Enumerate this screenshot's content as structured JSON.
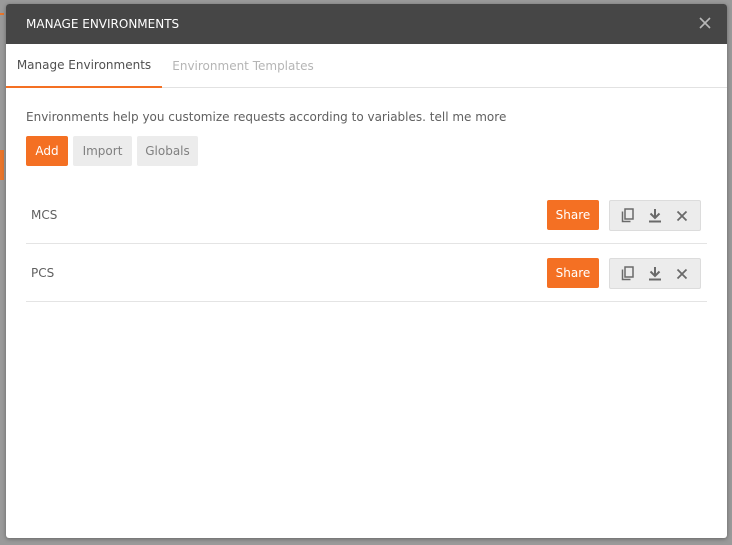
{
  "modal": {
    "title": "MANAGE ENVIRONMENTS",
    "close_icon": "close-icon"
  },
  "tabs": [
    {
      "label": "Manage Environments",
      "active": true
    },
    {
      "label": "Environment Templates",
      "active": false
    }
  ],
  "help": {
    "text": "Environments help you customize requests according to variables.",
    "link_label": "tell me more"
  },
  "buttons": {
    "add_label": "Add",
    "import_label": "Import",
    "globals_label": "Globals"
  },
  "environments": [
    {
      "name": "MCS",
      "share_label": "Share"
    },
    {
      "name": "PCS",
      "share_label": "Share"
    }
  ],
  "icons": {
    "duplicate": "duplicate-icon",
    "download": "download-icon",
    "delete": "delete-icon"
  },
  "colors": {
    "accent": "#f47023",
    "header_bg": "#464646",
    "button_bg": "#ececec"
  }
}
